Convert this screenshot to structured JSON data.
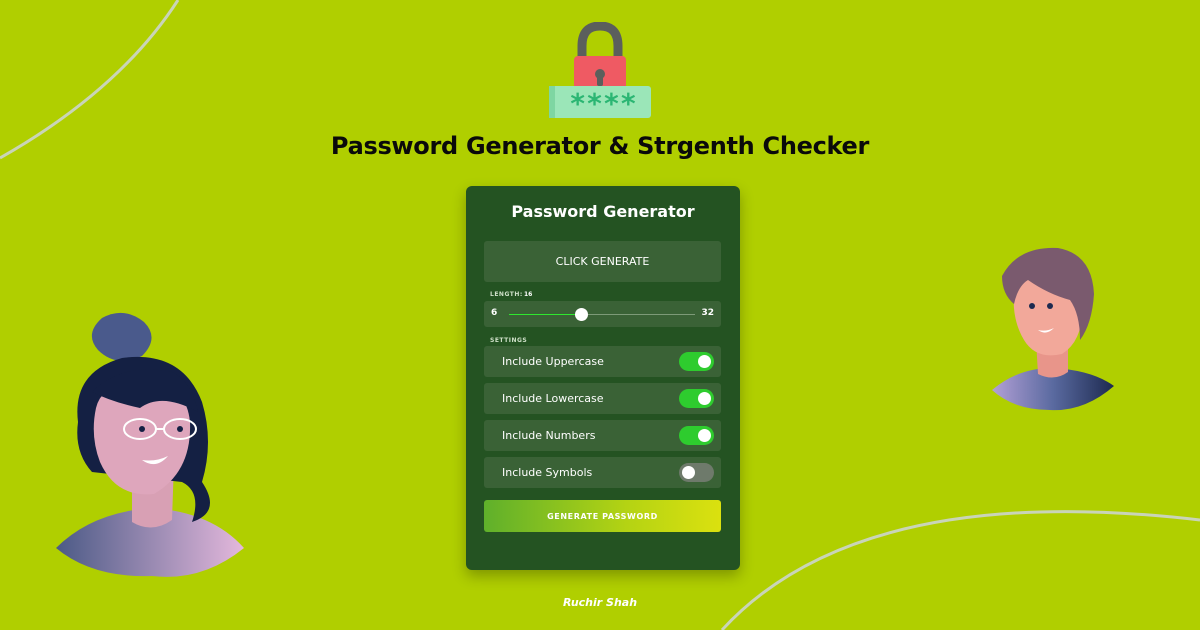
{
  "header": {
    "title": "Password Generator & Strgenth Checker",
    "logo_icon": "lock-password-icon",
    "logo_mask": "****"
  },
  "card": {
    "title": "Password Generator",
    "result_text": "CLICK GENERATE",
    "length": {
      "label": "LENGTH:",
      "value": "16",
      "min": "6",
      "max": "32"
    },
    "settings_label": "SETTINGS",
    "settings": [
      {
        "label": "Include Uppercase",
        "enabled": true
      },
      {
        "label": "Include Lowercase",
        "enabled": true
      },
      {
        "label": "Include Numbers",
        "enabled": true
      },
      {
        "label": "Include Symbols",
        "enabled": false
      }
    ],
    "generate_button": "GENERATE PASSWORD"
  },
  "footer": {
    "author": "Ruchir Shah"
  },
  "colors": {
    "background": "#b0cf00",
    "card": "#245322",
    "row": "#3a6236",
    "toggle_on": "#2ecc2e",
    "toggle_off": "#6e7a6b",
    "button_gradient_start": "#5fb02b",
    "button_gradient_end": "#dbe10f"
  }
}
